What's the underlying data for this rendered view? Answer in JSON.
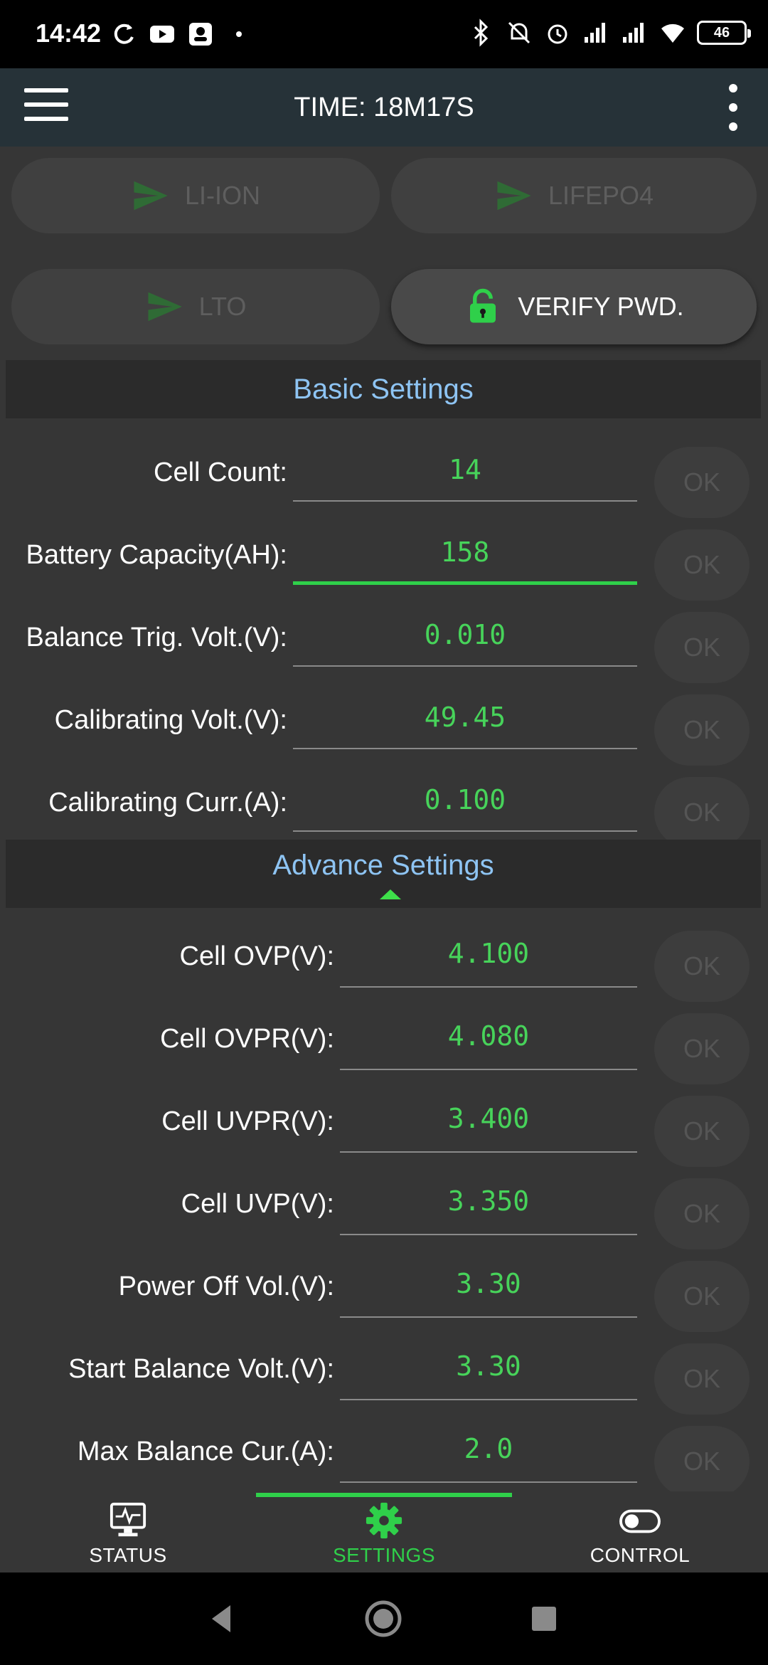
{
  "status_bar": {
    "time": "14:42",
    "left_icons": [
      "sync-icon",
      "youtube-icon",
      "app-icon"
    ],
    "right_icons": [
      "bluetooth-icon",
      "mute-icon",
      "alarm-icon",
      "signal-icon",
      "signal-icon",
      "wifi-icon"
    ],
    "battery": "46"
  },
  "appbar": {
    "title": "TIME: 18M17S"
  },
  "chips": {
    "li_ion": "LI-ION",
    "lifepo4": "LIFEPO4",
    "lto": "LTO",
    "verify": "VERIFY PWD."
  },
  "basic": {
    "header": "Basic Settings",
    "rows": [
      {
        "label": "Cell Count:",
        "value": "14",
        "ok": "OK"
      },
      {
        "label": "Battery Capacity(AH):",
        "value": "158",
        "ok": "OK"
      },
      {
        "label": "Balance Trig. Volt.(V):",
        "value": "0.010",
        "ok": "OK"
      },
      {
        "label": "Calibrating Volt.(V):",
        "value": "49.45",
        "ok": "OK"
      },
      {
        "label": "Calibrating Curr.(A):",
        "value": "0.100",
        "ok": "OK"
      }
    ]
  },
  "advance": {
    "header": "Advance Settings",
    "rows": [
      {
        "label": "Cell OVP(V):",
        "value": "4.100",
        "ok": "OK"
      },
      {
        "label": "Cell OVPR(V):",
        "value": "4.080",
        "ok": "OK"
      },
      {
        "label": "Cell UVPR(V):",
        "value": "3.400",
        "ok": "OK"
      },
      {
        "label": "Cell UVP(V):",
        "value": "3.350",
        "ok": "OK"
      },
      {
        "label": "Power Off Vol.(V):",
        "value": "3.30",
        "ok": "OK"
      },
      {
        "label": "Start Balance Volt.(V):",
        "value": "3.30",
        "ok": "OK"
      },
      {
        "label": "Max Balance Cur.(A):",
        "value": "2.0",
        "ok": "OK"
      }
    ]
  },
  "bottom_nav": {
    "status": "STATUS",
    "settings": "SETTINGS",
    "control": "CONTROL",
    "active": "settings"
  },
  "colors": {
    "accent_green": "#2fd04a",
    "value_green": "#47d35a",
    "header_blue": "#8ec4f3",
    "appbar": "#263238",
    "background": "#363636"
  }
}
